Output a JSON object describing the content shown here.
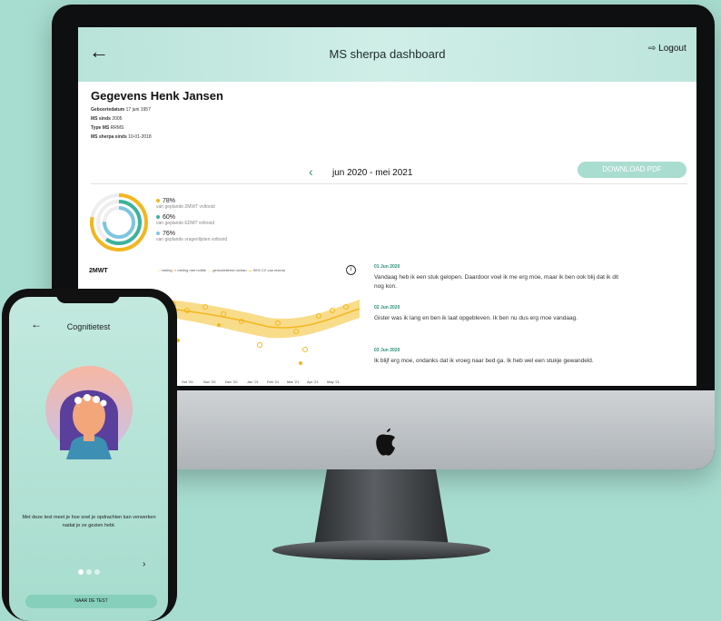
{
  "dashboard": {
    "header_title": "MS sherpa dashboard",
    "logout_label": "Logout",
    "patient_title": "Gegevens Henk Jansen",
    "info": [
      {
        "label": "Geboortedatum",
        "value": "17 juni 1957"
      },
      {
        "label": "MS sinds",
        "value": "2005"
      },
      {
        "label": "Type MS",
        "value": "RRMS"
      },
      {
        "label": "MS sherpa sinds",
        "value": "10-01-2018"
      }
    ],
    "period": "jun 2020 - mei 2021",
    "download_pdf": "DOWNLOAD PDF",
    "completion": [
      {
        "pct": "78%",
        "desc": "van geplande 2MWT voltooid",
        "color": "#f3b61f"
      },
      {
        "pct": "60%",
        "desc": "van geplande EDMT voltooid",
        "color": "#3bb39a"
      },
      {
        "pct": "76%",
        "desc": "van geplande vragenlijsten voltooid",
        "color": "#7cc6e0"
      }
    ],
    "chart": {
      "title": "2MWT",
      "legend": [
        "meting",
        "meting met notitie",
        "gemodelleerd niveau",
        "90% CI* van niveau"
      ],
      "x_ticks": [
        "Oct '20",
        "Nov '20",
        "Dec '20",
        "Jan '21",
        "Feb '21",
        "Mar '21",
        "Apr '21",
        "May '21"
      ],
      "accent": "#f3b61f"
    },
    "journal": [
      {
        "date": "01 Jun 2020",
        "text": "Vandaag heb ik een stuk gelopen. Daardoor voel ik me erg moe, maar ik ben ook blij dat ik dit nog kon."
      },
      {
        "date": "02 Jun 2020",
        "text": "Gister was ik lang en ben ik laat opgebleven. Ik ben nu dus erg moe vandaag."
      },
      {
        "date": "03 Jun 2020",
        "text": "Ik blijf erg moe, ondanks dat ik vroeg naar bed ga. Ik heb wel een stukje gewandeld."
      }
    ]
  },
  "phone": {
    "title": "Cognitietest",
    "description": "Met deze test meet je hoe snel je opdrachten kan verwerken nadat je ze gezien hebt.",
    "button": "NAAR DE TEST"
  }
}
